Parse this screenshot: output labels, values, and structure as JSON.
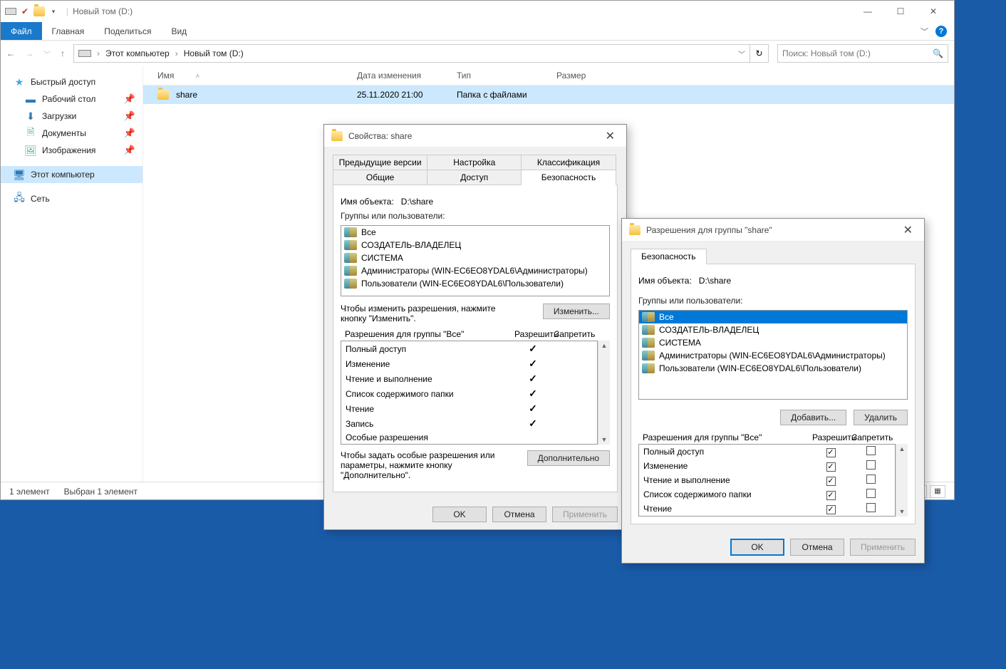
{
  "explorer": {
    "qat": [
      "drive",
      "check",
      "folder"
    ],
    "title": "Новый том (D:)",
    "ribbon": {
      "file": "Файл",
      "tabs": [
        "Главная",
        "Поделиться",
        "Вид"
      ]
    },
    "breadcrumb": [
      "Этот компьютер",
      "Новый том (D:)"
    ],
    "search_placeholder": "Поиск: Новый том (D:)",
    "sidebar": {
      "quick": "Быстрый доступ",
      "items": [
        {
          "label": "Рабочий стол",
          "pinned": true,
          "icon": "desktop"
        },
        {
          "label": "Загрузки",
          "pinned": true,
          "icon": "downloads"
        },
        {
          "label": "Документы",
          "pinned": true,
          "icon": "documents"
        },
        {
          "label": "Изображения",
          "pinned": true,
          "icon": "pictures"
        }
      ],
      "thispc": "Этот компьютер",
      "network": "Сеть"
    },
    "columns": [
      "Имя",
      "Дата изменения",
      "Тип",
      "Размер"
    ],
    "rows": [
      {
        "name": "share",
        "date": "25.11.2020 21:00",
        "type": "Папка с файлами",
        "size": ""
      }
    ],
    "status": {
      "count": "1 элемент",
      "sel": "Выбран 1 элемент"
    }
  },
  "props": {
    "title": "Свойства: share",
    "tabs_row1": [
      "Предыдущие версии",
      "Настройка",
      "Классификация"
    ],
    "tabs_row2": [
      "Общие",
      "Доступ",
      "Безопасность"
    ],
    "active_tab": "Безопасность",
    "obj_label": "Имя объекта:",
    "obj_path": "D:\\share",
    "groups_label": "Группы или пользователи:",
    "groups": [
      "Все",
      "СОЗДАТЕЛЬ-ВЛАДЕЛЕЦ",
      "СИСТЕМА",
      "Администраторы (WIN-EC6EO8YDAL6\\Администраторы)",
      "Пользователи (WIN-EC6EO8YDAL6\\Пользователи)"
    ],
    "edit_hint": "Чтобы изменить разрешения, нажмите кнопку \"Изменить\".",
    "edit_btn": "Изменить...",
    "perm_for": "Разрешения для группы \"Все\"",
    "allow": "Разрешить",
    "deny": "Запретить",
    "perms": [
      {
        "name": "Полный доступ",
        "allow": true,
        "deny": false
      },
      {
        "name": "Изменение",
        "allow": true,
        "deny": false
      },
      {
        "name": "Чтение и выполнение",
        "allow": true,
        "deny": false
      },
      {
        "name": "Список содержимого папки",
        "allow": true,
        "deny": false
      },
      {
        "name": "Чтение",
        "allow": true,
        "deny": false
      },
      {
        "name": "Запись",
        "allow": true,
        "deny": false
      },
      {
        "name": "Особые разрешения",
        "allow": false,
        "deny": false
      }
    ],
    "adv_hint": "Чтобы задать особые разрешения или параметры, нажмите кнопку \"Дополнительно\".",
    "adv_btn": "Дополнительно",
    "ok": "OK",
    "cancel": "Отмена",
    "apply": "Применить"
  },
  "perms": {
    "title": "Разрешения для группы \"share\"",
    "tab": "Безопасность",
    "obj_label": "Имя объекта:",
    "obj_path": "D:\\share",
    "groups_label": "Группы или пользователи:",
    "groups": [
      "Все",
      "СОЗДАТЕЛЬ-ВЛАДЕЛЕЦ",
      "СИСТЕМА",
      "Администраторы (WIN-EC6EO8YDAL6\\Администраторы)",
      "Пользователи (WIN-EC6EO8YDAL6\\Пользователи)"
    ],
    "selected_group": 0,
    "add": "Добавить...",
    "remove": "Удалить",
    "perm_for": "Разрешения для группы \"Все\"",
    "allow": "Разрешить",
    "deny": "Запретить",
    "perms": [
      {
        "name": "Полный доступ",
        "allow": true,
        "deny": false
      },
      {
        "name": "Изменение",
        "allow": true,
        "deny": false
      },
      {
        "name": "Чтение и выполнение",
        "allow": true,
        "deny": false
      },
      {
        "name": "Список содержимого папки",
        "allow": true,
        "deny": false
      },
      {
        "name": "Чтение",
        "allow": true,
        "deny": false
      }
    ],
    "ok": "OK",
    "cancel": "Отмена",
    "apply": "Применить"
  }
}
